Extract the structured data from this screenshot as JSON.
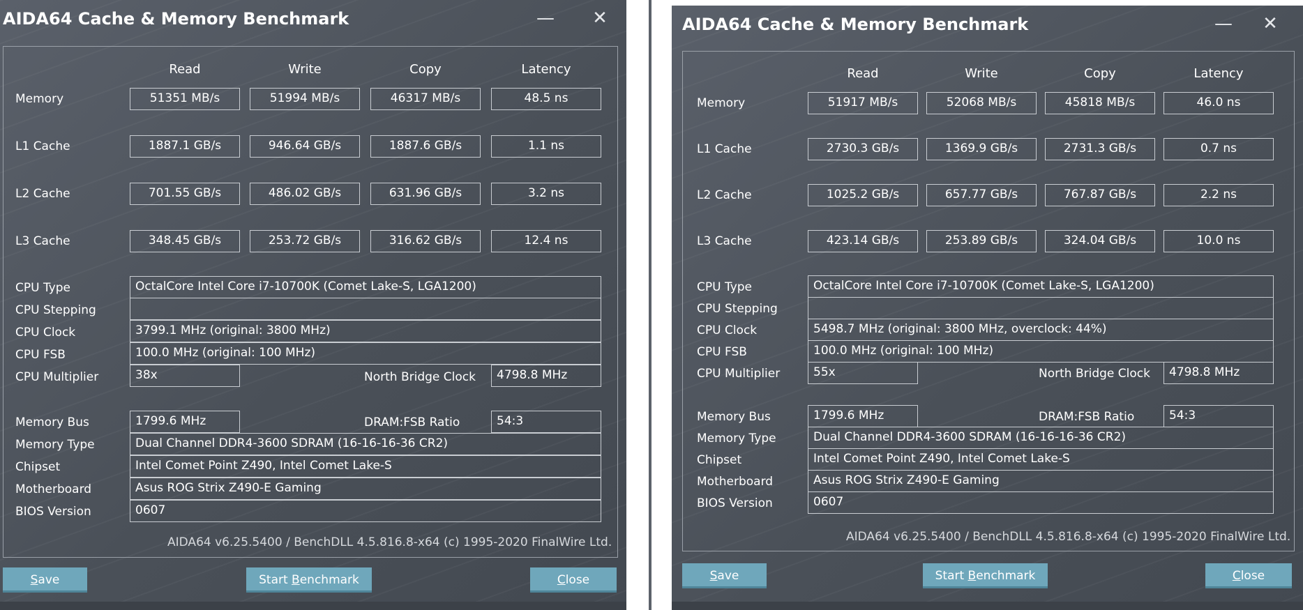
{
  "windows": [
    {
      "title": "AIDA64 Cache & Memory Benchmark",
      "columns": {
        "read": "Read",
        "write": "Write",
        "copy": "Copy",
        "latency": "Latency"
      },
      "rows": [
        {
          "label": "Memory",
          "read": "51351 MB/s",
          "write": "51994 MB/s",
          "copy": "46317 MB/s",
          "latency": "48.5 ns"
        },
        {
          "label": "L1 Cache",
          "read": "1887.1 GB/s",
          "write": "946.64 GB/s",
          "copy": "1887.6 GB/s",
          "latency": "1.1 ns"
        },
        {
          "label": "L2 Cache",
          "read": "701.55 GB/s",
          "write": "486.02 GB/s",
          "copy": "631.96 GB/s",
          "latency": "3.2 ns"
        },
        {
          "label": "L3 Cache",
          "read": "348.45 GB/s",
          "write": "253.72 GB/s",
          "copy": "316.62 GB/s",
          "latency": "12.4 ns"
        }
      ],
      "cpu": {
        "type_label": "CPU Type",
        "type": "OctalCore Intel Core i7-10700K  (Comet Lake-S, LGA1200)",
        "stepping_label": "CPU Stepping",
        "stepping": "",
        "clock_label": "CPU Clock",
        "clock": "3799.1 MHz  (original: 3800 MHz)",
        "fsb_label": "CPU FSB",
        "fsb": "100.0 MHz  (original: 100 MHz)",
        "mult_label": "CPU Multiplier",
        "mult": "38x",
        "nb_label": "North Bridge Clock",
        "nb": "4798.8 MHz"
      },
      "mem": {
        "bus_label": "Memory Bus",
        "bus": "1799.6 MHz",
        "ratio_label": "DRAM:FSB Ratio",
        "ratio": "54:3",
        "type_label": "Memory Type",
        "type": "Dual Channel DDR4-3600 SDRAM  (16-16-16-36 CR2)",
        "chipset_label": "Chipset",
        "chipset": "Intel Comet Point Z490, Intel Comet Lake-S",
        "mb_label": "Motherboard",
        "mb": "Asus ROG Strix Z490-E Gaming",
        "bios_label": "BIOS Version",
        "bios": "0607"
      },
      "footer": "AIDA64 v6.25.5400 / BenchDLL 4.5.816.8-x64  (c) 1995-2020 FinalWire Ltd.",
      "buttons": {
        "save_pre": "",
        "save_u": "S",
        "save_post": "ave",
        "start_pre": "Start ",
        "start_u": "B",
        "start_post": "enchmark",
        "close_pre": "",
        "close_u": "C",
        "close_post": "lose"
      }
    },
    {
      "title": "AIDA64 Cache & Memory Benchmark",
      "columns": {
        "read": "Read",
        "write": "Write",
        "copy": "Copy",
        "latency": "Latency"
      },
      "rows": [
        {
          "label": "Memory",
          "read": "51917 MB/s",
          "write": "52068 MB/s",
          "copy": "45818 MB/s",
          "latency": "46.0 ns"
        },
        {
          "label": "L1 Cache",
          "read": "2730.3 GB/s",
          "write": "1369.9 GB/s",
          "copy": "2731.3 GB/s",
          "latency": "0.7 ns"
        },
        {
          "label": "L2 Cache",
          "read": "1025.2 GB/s",
          "write": "657.77 GB/s",
          "copy": "767.87 GB/s",
          "latency": "2.2 ns"
        },
        {
          "label": "L3 Cache",
          "read": "423.14 GB/s",
          "write": "253.89 GB/s",
          "copy": "324.04 GB/s",
          "latency": "10.0 ns"
        }
      ],
      "cpu": {
        "type_label": "CPU Type",
        "type": "OctalCore Intel Core i7-10700K  (Comet Lake-S, LGA1200)",
        "stepping_label": "CPU Stepping",
        "stepping": "",
        "clock_label": "CPU Clock",
        "clock": "5498.7 MHz  (original: 3800 MHz, overclock: 44%)",
        "fsb_label": "CPU FSB",
        "fsb": "100.0 MHz  (original: 100 MHz)",
        "mult_label": "CPU Multiplier",
        "mult": "55x",
        "nb_label": "North Bridge Clock",
        "nb": "4798.8 MHz"
      },
      "mem": {
        "bus_label": "Memory Bus",
        "bus": "1799.6 MHz",
        "ratio_label": "DRAM:FSB Ratio",
        "ratio": "54:3",
        "type_label": "Memory Type",
        "type": "Dual Channel DDR4-3600 SDRAM  (16-16-16-36 CR2)",
        "chipset_label": "Chipset",
        "chipset": "Intel Comet Point Z490, Intel Comet Lake-S",
        "mb_label": "Motherboard",
        "mb": "Asus ROG Strix Z490-E Gaming",
        "bios_label": "BIOS Version",
        "bios": "0607"
      },
      "footer": "AIDA64 v6.25.5400 / BenchDLL 4.5.816.8-x64  (c) 1995-2020 FinalWire Ltd.",
      "buttons": {
        "save_pre": "",
        "save_u": "S",
        "save_post": "ave",
        "start_pre": "Start ",
        "start_u": "B",
        "start_post": "enchmark",
        "close_pre": "",
        "close_u": "C",
        "close_post": "lose"
      }
    }
  ],
  "controls": {
    "minimize": "—",
    "close": "✕"
  }
}
